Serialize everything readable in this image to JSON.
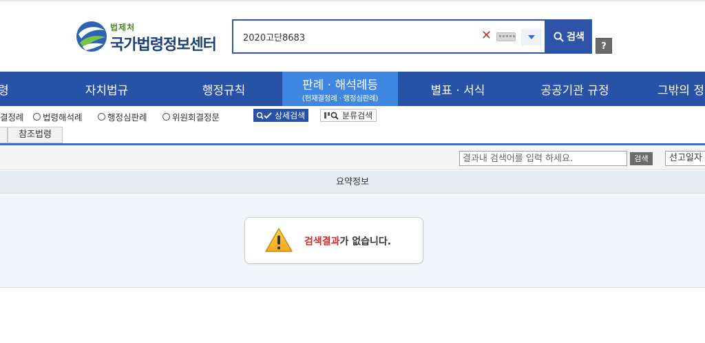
{
  "header": {
    "logo_small": "법제처",
    "logo_big": "국가법령정보센터"
  },
  "search": {
    "value": "2020고단8683",
    "clear_symbol": "✕",
    "button_label": "검색",
    "help_label": "?"
  },
  "nav": {
    "items": [
      {
        "label": "령"
      },
      {
        "label": "자치법규"
      },
      {
        "label": "행정규칙"
      },
      {
        "label": "판례 · 해석례등",
        "sub": "(헌재결정례 · 행정심판례)"
      },
      {
        "label": "별표 · 서식"
      },
      {
        "label": "공공기관 규정"
      },
      {
        "label": "그밖의 정"
      }
    ]
  },
  "filters": {
    "options": [
      "결정례",
      "법령해석례",
      "행정심판례",
      "위원회결정문"
    ],
    "detail_search": "상세검색",
    "class_search": "분류검색"
  },
  "tabs": {
    "reference_law": "참조법령"
  },
  "result_bar": {
    "in_search_placeholder": "결과내 검색어를 입력 하세요.",
    "in_search_button": "검색",
    "sort_value": "선고일자"
  },
  "table": {
    "summary_header": "요약정보"
  },
  "message": {
    "highlight": "검색결과",
    "rest": "가 없습니다."
  },
  "colors": {
    "primary": "#2852a5",
    "active_tab": "#3e86e0",
    "alert_red": "#d12b2b"
  }
}
